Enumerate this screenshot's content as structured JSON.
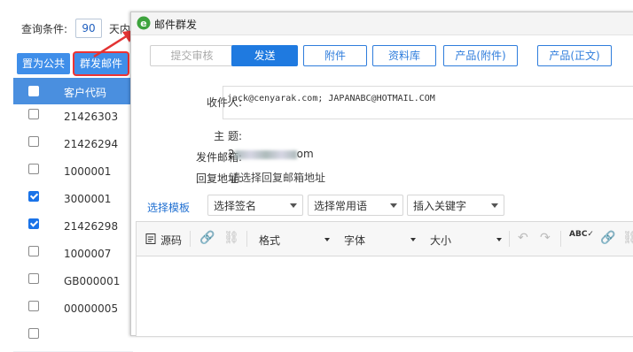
{
  "background": {
    "query_label": "查询条件:",
    "days_value": "90",
    "days_suffix": "天内",
    "public_button": "置为公共",
    "mass_mail_button": "群发邮件",
    "table": {
      "header": "客户代码",
      "rows": [
        {
          "code": "21426303",
          "checked": false
        },
        {
          "code": "21426294",
          "checked": false
        },
        {
          "code": "1000001",
          "checked": false
        },
        {
          "code": "3000001",
          "checked": true
        },
        {
          "code": "21426298",
          "checked": true
        },
        {
          "code": "1000007",
          "checked": false
        },
        {
          "code": "GB000001",
          "checked": false
        },
        {
          "code": "00000005",
          "checked": false
        },
        {
          "code": "",
          "checked": false
        }
      ]
    },
    "highlight_color": "#e33333"
  },
  "dialog": {
    "title": "邮件群发",
    "toolbar": {
      "submit_review": "提交审核",
      "send": "发送",
      "attachment": "附件",
      "library": "资料库",
      "product_attachment": "产品(附件)",
      "product_body": "产品(正文)"
    },
    "form": {
      "recipient_label": "收件人:",
      "recipient_value": "jack@cenyarak.com; JAPANABC@HOTMAIL.COM",
      "subject_label": "主    题:",
      "sender_label": "发件邮箱:",
      "sender_value_visible": "2",
      "sender_value_suffix": "om",
      "reply_label": "回复地址:",
      "reply_value": "请选择回复邮箱地址"
    },
    "template_link": "选择模板",
    "dropdowns": {
      "signature": "选择签名",
      "phrases": "选择常用语",
      "keywords": "插入关键字"
    },
    "editor": {
      "source": "源码",
      "format": "格式",
      "font": "字体",
      "size": "大小"
    },
    "accent_color": "#1f7ae0"
  }
}
